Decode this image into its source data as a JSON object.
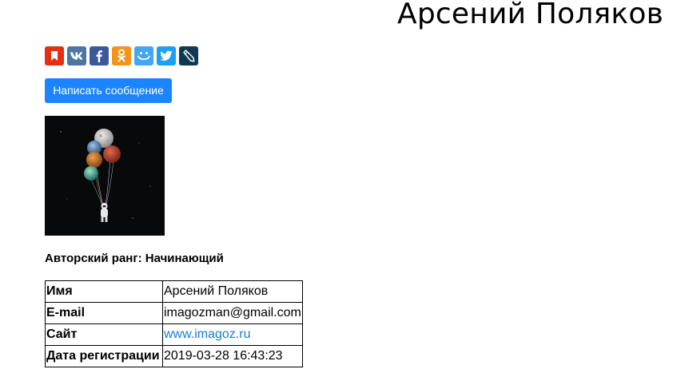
{
  "profile": {
    "name": "Арсений Поляков",
    "rank_label": "Авторский ранг: Начинающий",
    "message_button": "Написать сообщение"
  },
  "share_buttons": [
    {
      "name": "bookmark-icon",
      "color": "#e52e12"
    },
    {
      "name": "vk-icon",
      "color": "#4c75a3"
    },
    {
      "name": "facebook-icon",
      "color": "#3b5998"
    },
    {
      "name": "odnoklassniki-icon",
      "color": "#f59419"
    },
    {
      "name": "moimir-icon",
      "color": "#42a5f5"
    },
    {
      "name": "twitter-icon",
      "color": "#1da1f2"
    },
    {
      "name": "livejournal-icon",
      "color": "#0d3a52"
    }
  ],
  "info_table": {
    "name_label": "Имя",
    "name_value": "Арсений Поляков",
    "email_label": "E-mail",
    "email_value": "imagozman@gmail.com",
    "site_label": "Сайт",
    "site_value": "www.imagoz.ru",
    "date_label": "Дата регистрации",
    "date_value": "2019-03-28 16:43:23"
  },
  "colors": {
    "accent": "#1a85ff",
    "link": "#1a7ad9"
  }
}
